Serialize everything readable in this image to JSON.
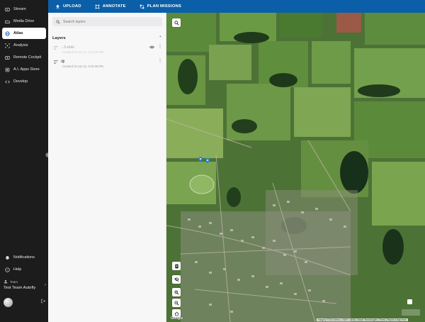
{
  "sidebar": {
    "items": [
      {
        "label": "Stream",
        "icon": "stream-icon",
        "active": false
      },
      {
        "label": "Media Drive",
        "icon": "folder-icon",
        "active": false
      },
      {
        "label": "Atlas",
        "icon": "globe-icon",
        "active": true
      },
      {
        "label": "Analysis",
        "icon": "analysis-icon",
        "active": false
      },
      {
        "label": "Remote Cockpit",
        "icon": "cockpit-icon",
        "active": false
      },
      {
        "label": "A.I. Apps Store",
        "icon": "apps-icon",
        "active": false
      },
      {
        "label": "Develop",
        "icon": "code-icon",
        "active": false
      }
    ],
    "bottom": {
      "notifications": "Notifications",
      "help": "Help"
    },
    "team": {
      "label": "Team",
      "name": "Test Team Autofly"
    }
  },
  "toolbar": {
    "upload_label": "UPLOAD",
    "annotate_label": "ANNOTATE",
    "plan_label": "PLAN MISSIONS"
  },
  "panel": {
    "search_placeholder": "Search layers",
    "layers_title": "Layers",
    "layers": [
      {
        "name": "...5-dots",
        "date": "Created 16 Apr 24, 2:51:26 PM",
        "faded": true,
        "visible": true
      },
      {
        "name": "dji",
        "date": "Created 16 Apr 24, 3:16:26 PM",
        "faded": false,
        "visible": false
      }
    ]
  },
  "map": {
    "provider": "Google",
    "attribution": "Imagery ©2024 Airbus, CNES / Airbus, Maxar Technologies | Terms | Report a map error",
    "controls": [
      "draw-polygon",
      "hide-layer",
      "zoom-in",
      "zoom-out",
      "home"
    ]
  },
  "colors": {
    "topbar": "#0a5fa8",
    "sidebar": "#1c1c1c",
    "panel": "#f7f7f8",
    "accent_pin": "#1e88e5"
  }
}
